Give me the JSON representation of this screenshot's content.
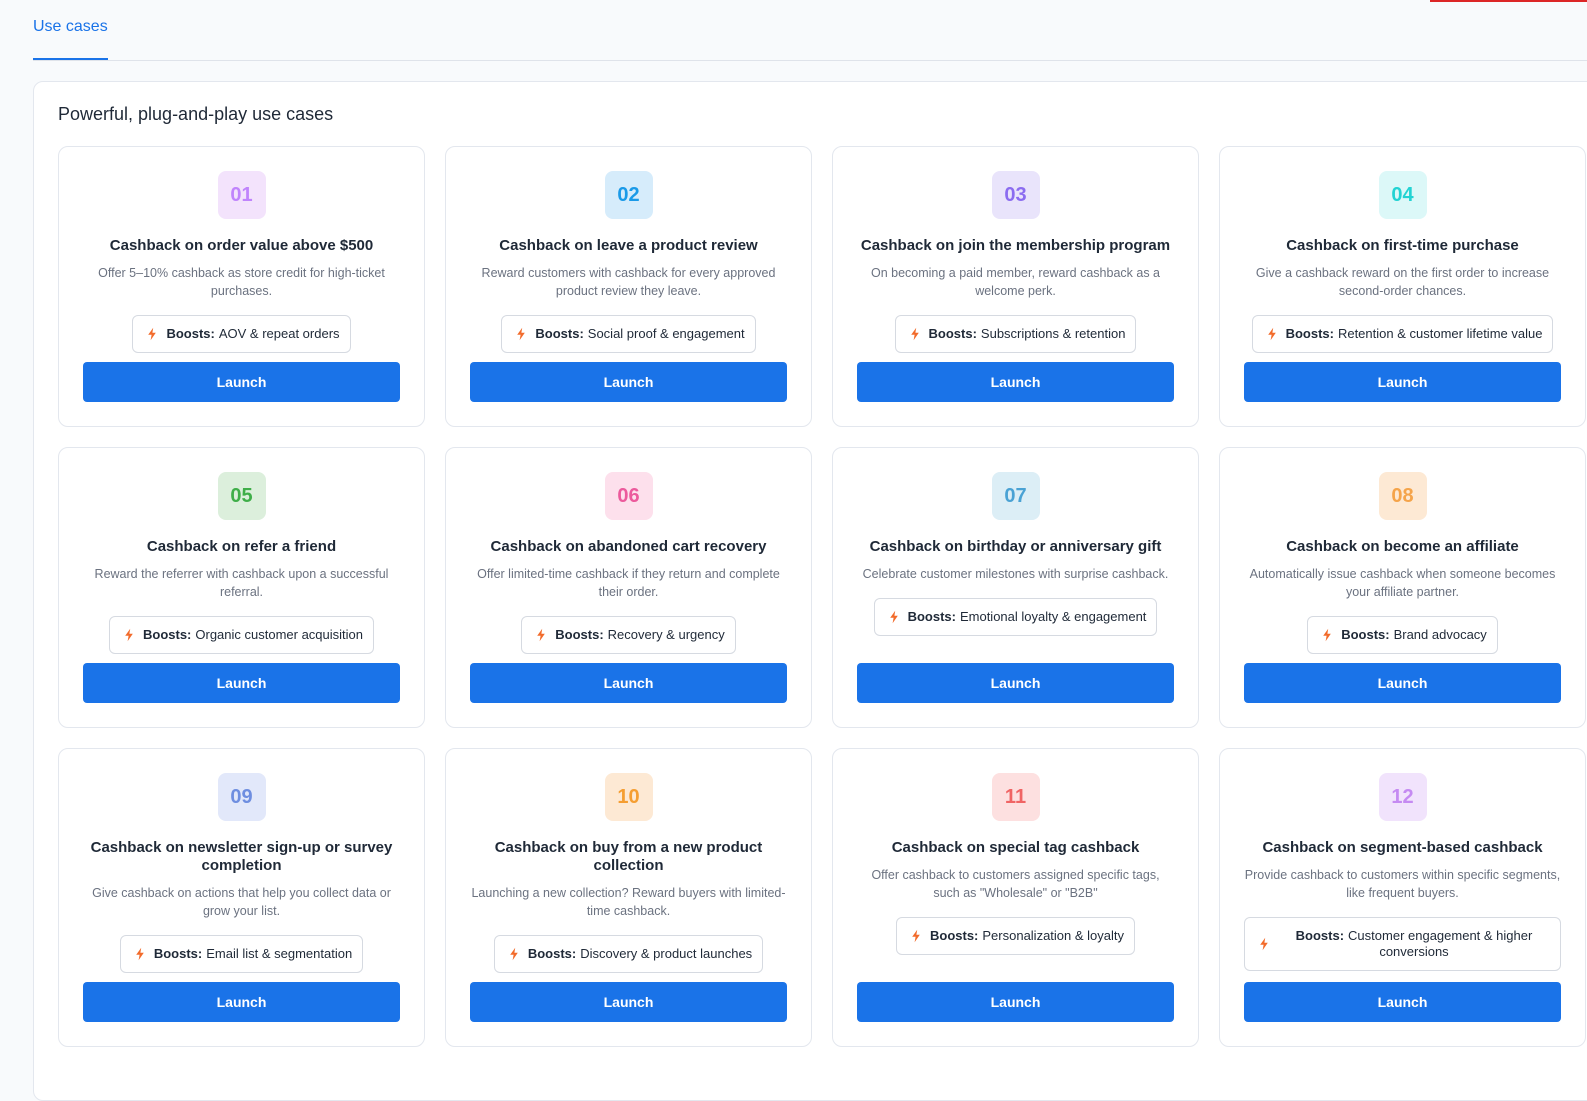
{
  "tabs": [
    {
      "label": "Use cases",
      "active": true
    }
  ],
  "panel": {
    "title": "Powerful, plug-and-play use cases"
  },
  "boosts_prefix": "Boosts:",
  "launch_label": "Launch",
  "cards": [
    {
      "num": "01",
      "bg": "#f3e3fc",
      "fg": "#c084fc",
      "title": "Cashback on order value above $500",
      "desc": "Offer 5–10% cashback as store credit for high-ticket purchases.",
      "boost": "AOV & repeat orders"
    },
    {
      "num": "02",
      "bg": "#d6ecfb",
      "fg": "#1a9ae8",
      "title": "Cashback on leave a product review",
      "desc": "Reward customers with cashback for every approved product review they leave.",
      "boost": "Social proof & engagement"
    },
    {
      "num": "03",
      "bg": "#e9e4fb",
      "fg": "#8b6cf0",
      "title": "Cashback on join the membership program",
      "desc": "On becoming a paid member, reward cashback as a welcome perk.",
      "boost": "Subscriptions & retention"
    },
    {
      "num": "04",
      "bg": "#dcf8f8",
      "fg": "#22d3d3",
      "title": "Cashback on first-time purchase",
      "desc": "Give a cashback reward on the first order to increase second-order chances.",
      "boost": "Retention & customer lifetime value"
    },
    {
      "num": "05",
      "bg": "#dcefdc",
      "fg": "#3fae49",
      "title": "Cashback on refer a friend",
      "desc": "Reward the referrer with cashback upon a successful referral.",
      "boost": "Organic customer acquisition"
    },
    {
      "num": "06",
      "bg": "#fde0ec",
      "fg": "#ec5a9c",
      "title": "Cashback on abandoned cart recovery",
      "desc": "Offer limited-time cashback if they return and complete their order.",
      "boost": "Recovery & urgency"
    },
    {
      "num": "07",
      "bg": "#dceef6",
      "fg": "#4aa2d4",
      "title": "Cashback on birthday or anniversary gift",
      "desc": "Celebrate customer milestones with surprise cashback.",
      "boost": "Emotional loyalty & engagement"
    },
    {
      "num": "08",
      "bg": "#fde9d4",
      "fg": "#f5a44a",
      "title": "Cashback on become an affiliate",
      "desc": "Automatically issue cashback when someone becomes your affiliate partner.",
      "boost": "Brand advocacy"
    },
    {
      "num": "09",
      "bg": "#e2e8fa",
      "fg": "#6e8ee0",
      "title": "Cashback on newsletter sign-up or survey completion",
      "desc": "Give cashback on actions that help you collect data or grow your list.",
      "boost": "Email list & segmentation"
    },
    {
      "num": "10",
      "bg": "#fde9d4",
      "fg": "#f59e32",
      "title": "Cashback on buy from a new product collection",
      "desc": "Launching a new collection? Reward buyers with limited-time cashback.",
      "boost": "Discovery & product launches"
    },
    {
      "num": "11",
      "bg": "#fde0e0",
      "fg": "#f06464",
      "title": "Cashback on special tag cashback",
      "desc": "Offer cashback to customers assigned specific tags, such as \"Wholesale\" or \"B2B\"",
      "boost": "Personalization & loyalty"
    },
    {
      "num": "12",
      "bg": "#f1e3fc",
      "fg": "#c58af2",
      "title": "Cashback on segment-based cashback",
      "desc": "Provide cashback to customers within specific segments, like frequent buyers.",
      "boost": "Customer engagement & higher conversions"
    }
  ],
  "colors": {
    "accent": "#1a73e8",
    "bolt": "#f26b2b"
  },
  "icons": {
    "boost": "bolt-icon"
  }
}
